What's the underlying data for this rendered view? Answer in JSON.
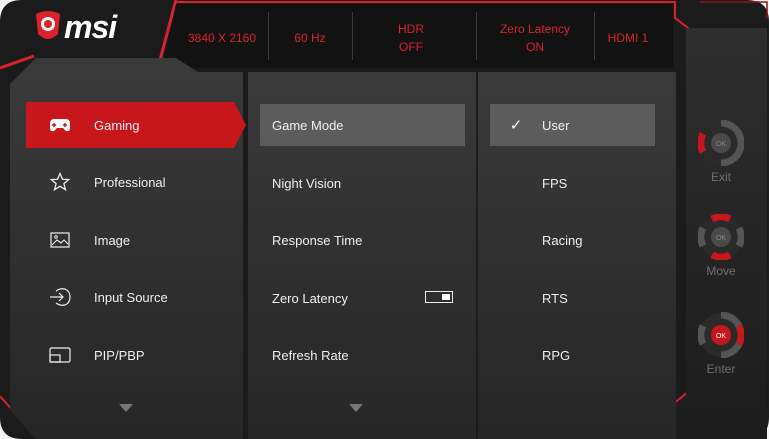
{
  "brand": {
    "name": "msi",
    "logo_icon": "msi-dragon-shield-icon",
    "accent": "#d8232a"
  },
  "status_bar": [
    {
      "line1": "3840 X 2160",
      "line2": ""
    },
    {
      "line1": "60 Hz",
      "line2": ""
    },
    {
      "line1": "HDR",
      "line2": "OFF"
    },
    {
      "line1": "Zero Latency",
      "line2": "ON"
    },
    {
      "line1": "HDMI 1",
      "line2": ""
    }
  ],
  "categories": [
    {
      "label": "Gaming",
      "icon": "gamepad-icon",
      "selected": true
    },
    {
      "label": "Professional",
      "icon": "star-icon",
      "selected": false
    },
    {
      "label": "Image",
      "icon": "image-icon",
      "selected": false
    },
    {
      "label": "Input Source",
      "icon": "input-source-icon",
      "selected": false
    },
    {
      "label": "PIP/PBP",
      "icon": "pip-pbp-icon",
      "selected": false
    }
  ],
  "settings": [
    {
      "label": "Game Mode",
      "selected": true
    },
    {
      "label": "Night Vision",
      "selected": false
    },
    {
      "label": "Response Time",
      "selected": false
    },
    {
      "label": "Zero Latency",
      "selected": false,
      "toggle_on": true
    },
    {
      "label": "Refresh Rate",
      "selected": false
    }
  ],
  "options": [
    {
      "label": "User",
      "checked": true
    },
    {
      "label": "FPS",
      "checked": false
    },
    {
      "label": "Racing",
      "checked": false
    },
    {
      "label": "RTS",
      "checked": false
    },
    {
      "label": "RPG",
      "checked": false
    }
  ],
  "nav_keys": {
    "exit": {
      "label": "Exit",
      "center": "OK",
      "icon": "exit-key-icon"
    },
    "move": {
      "label": "Move",
      "center": "OK",
      "icon": "move-key-icon"
    },
    "enter": {
      "label": "Enter",
      "center": "OK",
      "icon": "enter-key-icon"
    }
  }
}
